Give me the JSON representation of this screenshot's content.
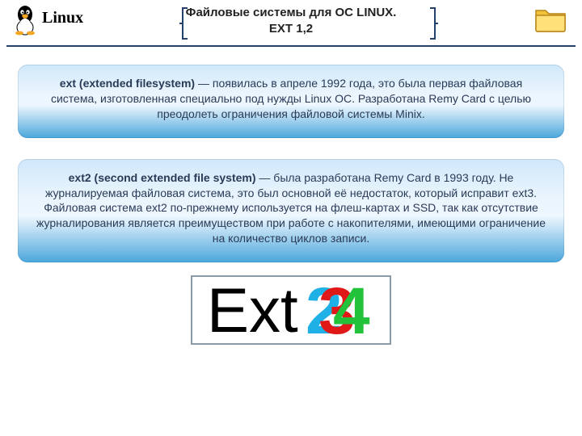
{
  "header": {
    "os_label": "Linux",
    "title_line1": "Файловые системы для ОС LINUX.",
    "title_line2": "EXT 1,2"
  },
  "panels": {
    "ext": {
      "lead": "ext (extended filesystem)",
      "body": " — появилась в апреле 1992 года, это была первая файловая система, изготовленная специально под нужды Linux ОС. Разработана Remy Card с целью преодолеть ограничения файловой системы Minix."
    },
    "ext2": {
      "lead": "ext2 (second extended file system)",
      "body": " — была разработана Remy Card в 1993 году. Не журналируемая файловая система, это был основной её недостаток, который исправит ext3. Файловая система ext2 по-прежнему используется на флеш-картах и  SSD, так как отсутствие журналирования является преимуществом при работе с накопителями, имеющими ограничение на количество циклов записи."
    }
  },
  "logo": {
    "text_main": "Ext",
    "digit_back": "2",
    "digit_mid": "3",
    "digit_front": "4",
    "colors": {
      "main": "#000000",
      "d2": "#1fb0e6",
      "d3": "#e01818",
      "d4": "#22c23a"
    }
  },
  "icons": {
    "tux": "tux-penguin-icon",
    "folder": "folder-icon",
    "bracket_left": "bracket-left-icon",
    "bracket_right": "bracket-right-icon"
  }
}
